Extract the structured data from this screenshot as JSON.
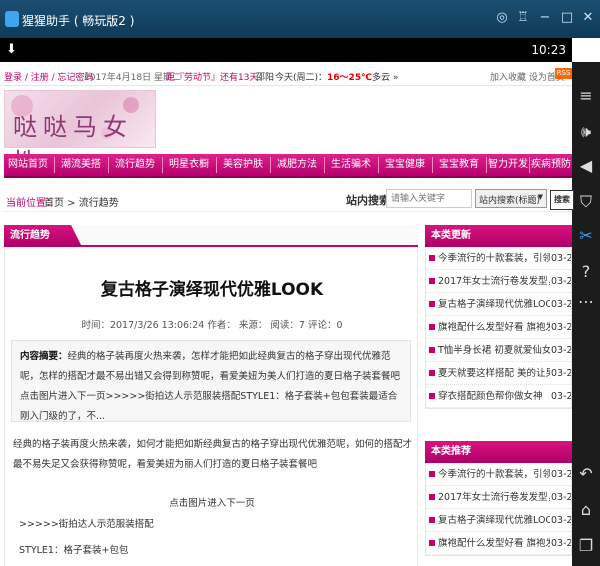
{
  "window": {
    "title": "猩猩助手 ( 畅玩版2 )",
    "controls": [
      "◎",
      "♖",
      "−",
      "□",
      "✕"
    ]
  },
  "statusbar": {
    "download_icon": "⬇",
    "time": "10:23"
  },
  "sidebar_icons": [
    {
      "name": "menu-icon",
      "glyph": "≡"
    },
    {
      "name": "volume-icon",
      "glyph": "🕪"
    },
    {
      "name": "volume-down-icon",
      "glyph": "◀"
    },
    {
      "name": "screenshot-icon",
      "glyph": "⛉"
    },
    {
      "name": "scissors-icon",
      "glyph": "✂"
    },
    {
      "name": "help-icon",
      "glyph": "?"
    },
    {
      "name": "more-icon",
      "glyph": "⋯"
    },
    {
      "name": "back-icon",
      "glyph": "↶"
    },
    {
      "name": "home-icon",
      "glyph": "⌂"
    },
    {
      "name": "recent-apps-icon",
      "glyph": "❐"
    }
  ],
  "topbar": {
    "login": "登录 / 注册 / 忘记密码",
    "date": "2017年4月18日 星期二",
    "holiday": "距『劳动节』还有13天",
    "city": "邵阳",
    "weather_prefix": "今天(周二)：",
    "temperature": "16～25℃",
    "weather_suffix": "多云 »",
    "favorites": "加入收藏  设为首页",
    "rss": "RSS"
  },
  "banner": {
    "logo_text": "哒哒马女性"
  },
  "nav": {
    "items": [
      "网站首页",
      "潮流美搭",
      "流行趋势",
      "明星衣橱",
      "美容护肤",
      "减肥方法",
      "生活骗术",
      "宝宝健康",
      "宝宝教育",
      "智力开发",
      "疾病预防"
    ]
  },
  "breadcrumb": {
    "label": "当前位置：",
    "path": "首页 > 流行趋势",
    "search_label": "站内搜索",
    "search_placeholder": "请输入关键字",
    "search_select": "站内搜索(标题)",
    "search_button": "搜索"
  },
  "main": {
    "tab_label": "流行趋势",
    "title": "复古格子演绎现代优雅LOOK",
    "meta": "时间：2017/3/26 13:06:24   作者：   来源：   阅读：7   评论：0",
    "summary_label": "内容摘要：",
    "summary_text": "经典的格子装再度火热来袭，怎样才能把如此经典复古的格子穿出现代优雅范呢，怎样的搭配才最不易出错又会得到称赞呢，看爱美妞为美人们打造的夏日格子装套餐吧点击图片进入下一页>>>>>街拍达人示范服装搭配STYLE1：格子套装+包包套装最适合刚入门级的了，不...",
    "paragraph": "经典的格子装再度火热来袭，如何才能把如斯经典复古的格子穿出现代优雅范呢，如何的搭配才最不易失足又会获得称赞呢，看爱美妞为丽人们打造的夏日格子装套餐吧",
    "next_page": "点击图片进入下一页",
    "street": ">>>>>街拍达人示范服装搭配",
    "style1": "STYLE1：格子套装+包包"
  },
  "sidebar_panels": {
    "updates": {
      "title": "本类更新",
      "items": [
        {
          "title": "今季流行的十款套装，引领时",
          "date": "03-27"
        },
        {
          "title": "2017年女士流行卷发发型，",
          "date": "03-27"
        },
        {
          "title": "复古格子演绎现代优雅LOOK",
          "date": "03-26"
        },
        {
          "title": "旗袍配什么发型好看 旗袍发",
          "date": "03-26"
        },
        {
          "title": "T恤半身长裙 初夏就爱仙女范",
          "date": "03-25"
        },
        {
          "title": "夏天就要这样搭配 美的让男",
          "date": "03-25"
        },
        {
          "title": "穿衣搭配颜色帮你做女神",
          "date": "03-24"
        }
      ]
    },
    "recommended": {
      "title": "本类推荐",
      "items": [
        {
          "title": "今季流行的十款套装，引领时",
          "date": "03-27"
        },
        {
          "title": "2017年女士流行卷发发型，",
          "date": "03-27"
        },
        {
          "title": "复古格子演绎现代优雅LOOK",
          "date": "03-26"
        },
        {
          "title": "旗袍配什么发型好看 旗袍发",
          "date": "03-26"
        }
      ]
    }
  }
}
